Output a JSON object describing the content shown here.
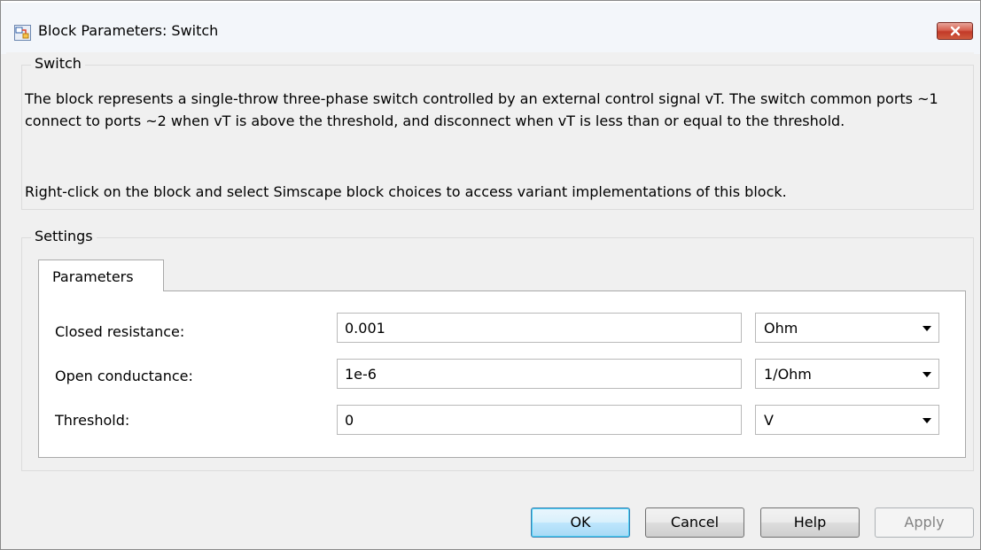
{
  "window": {
    "title": "Block Parameters: Switch",
    "icon": "simulink-block-icon",
    "close_icon": "close-icon"
  },
  "description_group": {
    "legend": "Switch",
    "paragraph1": "The block represents a single-throw three-phase switch controlled by an external control signal vT. The switch common ports ~1 connect to ports ~2 when vT is above the threshold, and disconnect when vT is less than or equal to the threshold.",
    "paragraph2": "Right-click on the block and select Simscape block choices to access variant implementations of this block."
  },
  "settings": {
    "legend": "Settings",
    "tabs": [
      {
        "label": "Parameters",
        "selected": true
      }
    ],
    "parameters": [
      {
        "label": "Closed resistance:",
        "value": "0.001",
        "unit": "Ohm"
      },
      {
        "label": "Open conductance:",
        "value": "1e-6",
        "unit": "1/Ohm"
      },
      {
        "label": "Threshold:",
        "value": "0",
        "unit": "V"
      }
    ]
  },
  "buttons": {
    "ok": "OK",
    "cancel": "Cancel",
    "help": "Help",
    "apply": "Apply"
  },
  "colors": {
    "dialog_bg": "#f0f0f0",
    "close_button": "#c23a28",
    "default_button_border": "#3c7fb1"
  }
}
